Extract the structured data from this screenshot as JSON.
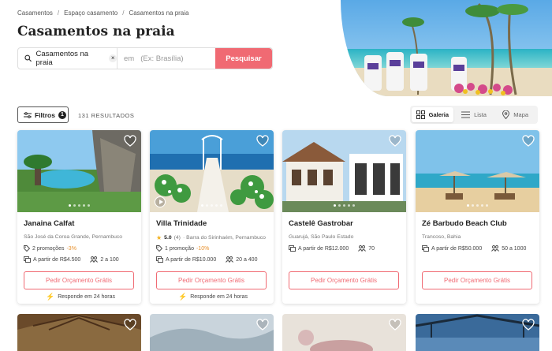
{
  "breadcrumb": [
    "Casamentos",
    "Espaço casamento",
    "Casamentos na praia"
  ],
  "page_title": "Casamentos na praia",
  "search": {
    "what_value": "Casamentos na praia",
    "where_prefix": "em",
    "where_placeholder": "(Ex: Brasília)",
    "button_label": "Pesquisar"
  },
  "toolbar": {
    "filters_label": "Filtros",
    "filters_count": "1",
    "results_count": "131 RESULTADOS",
    "views": [
      "Galeria",
      "Lista",
      "Mapa"
    ],
    "active_view": "Galeria"
  },
  "colors": {
    "accent": "#f06a73",
    "promo": "#e8912d",
    "star": "#f2b01e"
  },
  "cards": [
    {
      "name": "Janaina Calfat",
      "location": "São José da Coroa Grande, Pernambuco",
      "promo": "2 promoções",
      "promo_pct": "-3%",
      "price": "A partir de R$4.500",
      "capacity": "2 a 100",
      "button": "Pedir Orçamento Grátis",
      "responds": "Responde em 24 horas"
    },
    {
      "name": "Villa Trinidade",
      "rating": "5.0",
      "reviews": "(4)",
      "location": "· Barra do Sirinhaém, Pernambuco",
      "promo": "1 promoção",
      "promo_pct": "-10%",
      "price": "A partir de R$10.000",
      "capacity": "20 a 400",
      "button": "Pedir Orçamento Grátis",
      "responds": "Responde em 24 horas"
    },
    {
      "name": "Castelê Gastrobar",
      "location": "Guarujá, São Paulo Estado",
      "price": "A partir de R$12.000",
      "capacity": "70",
      "button": "Pedir Orçamento Grátis"
    },
    {
      "name": "Zé Barbudo Beach Club",
      "location": "Trancoso, Bahia",
      "price": "A partir de R$50.000",
      "capacity": "50 a 1000",
      "button": "Pedir Orçamento Grátis"
    }
  ]
}
